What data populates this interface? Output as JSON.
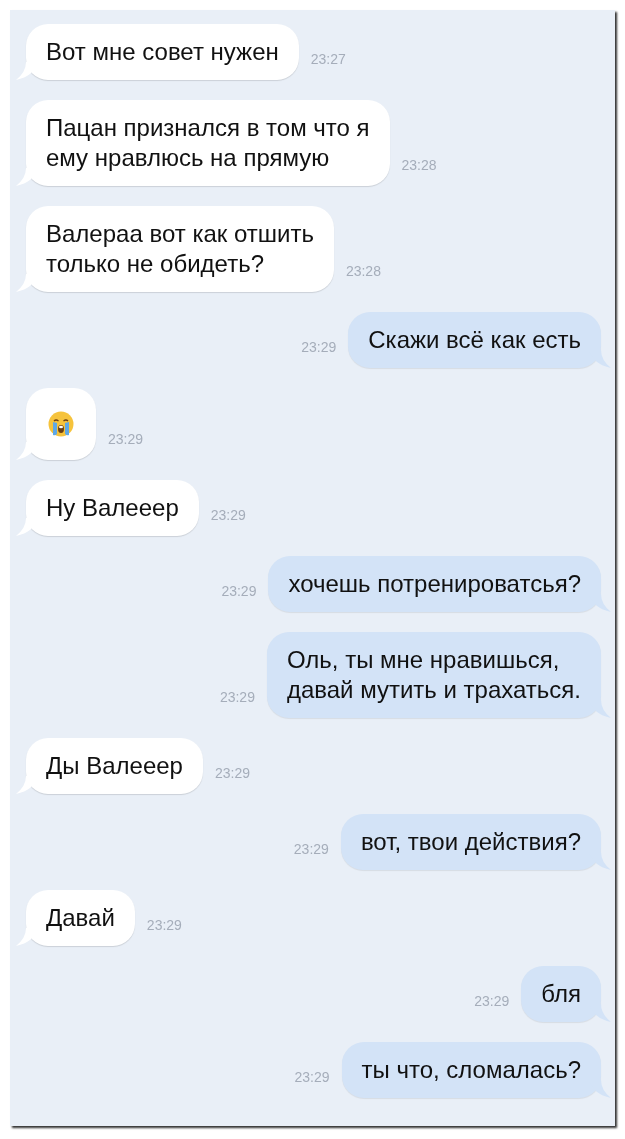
{
  "messages": [
    {
      "kind": "text",
      "outgoing": false,
      "text": "Вот мне совет нужен",
      "time": "23:27"
    },
    {
      "kind": "text",
      "outgoing": false,
      "text": "Пацан признался в том что я\nему нравлюсь на прямую",
      "time": "23:28"
    },
    {
      "kind": "text",
      "outgoing": false,
      "text": "Валераа вот как отшить\nтолько не обидеть?",
      "time": "23:28"
    },
    {
      "kind": "text",
      "outgoing": true,
      "text": "Скажи всё как есть",
      "time": "23:29"
    },
    {
      "kind": "emoji",
      "outgoing": false,
      "time": "23:29"
    },
    {
      "kind": "text",
      "outgoing": false,
      "text": "Ну Валееер",
      "time": "23:29"
    },
    {
      "kind": "text",
      "outgoing": true,
      "text": "хочешь потренироватсья?",
      "time": "23:29"
    },
    {
      "kind": "text",
      "outgoing": true,
      "text": "Оль, ты мне нравишься,\nдавай мутить и трахаться.",
      "time": "23:29"
    },
    {
      "kind": "text",
      "outgoing": false,
      "text": "Ды Валееер",
      "time": "23:29"
    },
    {
      "kind": "text",
      "outgoing": true,
      "text": "вот, твои действия?",
      "time": "23:29"
    },
    {
      "kind": "text",
      "outgoing": false,
      "text": "Давай",
      "time": "23:29"
    },
    {
      "kind": "text",
      "outgoing": true,
      "text": "бля",
      "time": "23:29"
    },
    {
      "kind": "text",
      "outgoing": true,
      "text": "ты что, сломалась?",
      "time": "23:29"
    }
  ]
}
